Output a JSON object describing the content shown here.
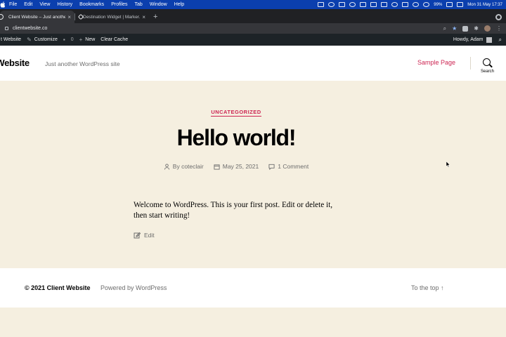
{
  "menubar": {
    "items": [
      "File",
      "Edit",
      "View",
      "History",
      "Bookmarks",
      "Profiles",
      "Tab",
      "Window",
      "Help"
    ],
    "battery": "99%",
    "clock": "Mon 31 May  17:37"
  },
  "tabs": [
    {
      "title": "Client Website – Just another W",
      "close": "×"
    },
    {
      "title": "Destination Widget | Marker.io",
      "close": "×"
    }
  ],
  "new_tab": "+",
  "address_bar": {
    "url": "clientwebsite.co"
  },
  "admin_bar": {
    "site": "t Website",
    "customize": "Customize",
    "comments": "0",
    "new": "New",
    "clear_cache": "Clear Cache",
    "howdy": "Howdy, Adam"
  },
  "header": {
    "site_title": "t Website",
    "description": "Just another WordPress site",
    "nav": "Sample Page",
    "search_label": "Search"
  },
  "post": {
    "category": "UNCATEGORIZED",
    "title": "Hello world!",
    "author": "By coteclair",
    "date": "May 25, 2021",
    "comments": "1 Comment",
    "body": "Welcome to WordPress. This is your first post. Edit or delete it, then start writing!",
    "edit": "Edit"
  },
  "footer": {
    "copyright": "© 2021 Client Website",
    "powered": "Powered by WordPress",
    "to_top": "To the top ↑"
  },
  "colors": {
    "accent": "#cd2653",
    "background": "#f5efe0",
    "menubar": "#0b3fae",
    "admin_bar": "#1d2327"
  }
}
